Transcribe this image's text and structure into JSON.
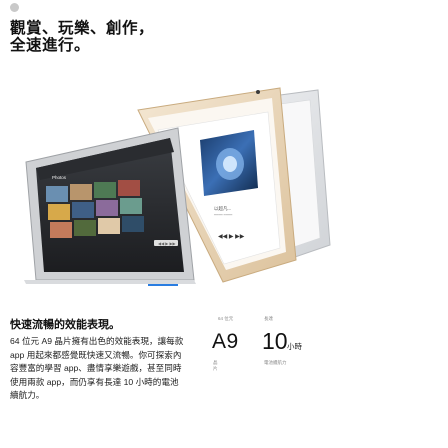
{
  "header": {
    "headline_line1": "觀賞、玩樂、創作，",
    "headline_line2": "全速進行。"
  },
  "illustration": {
    "front_ipad_app": "Photos",
    "rear_ipad_caption": "以超凡...",
    "controls": "◀◀  ▶  ▶▶"
  },
  "performance": {
    "heading": "快速流暢的效能表現。",
    "body": "64 位元 A9 晶片擁有出色的效能表現，讓每款 app 用起來都感覺既快速又流暢。你可探索內容豐富的學習 app、盡情享樂遊戲，甚至同時使用兩款 app，而仍享有長達 10 小時的電池續航力。"
  },
  "specs": {
    "chip": {
      "caption": "64 位元",
      "value": "A9",
      "sub": "晶片"
    },
    "battery": {
      "caption": "長達",
      "value": "10",
      "unit": "小時",
      "sub": "電池續航力"
    }
  },
  "colors": {
    "accent_blue": "#2a7de1",
    "silver": "#d8dadd",
    "gold": "#e9d3b4",
    "space_gray": "#2b2c30"
  }
}
